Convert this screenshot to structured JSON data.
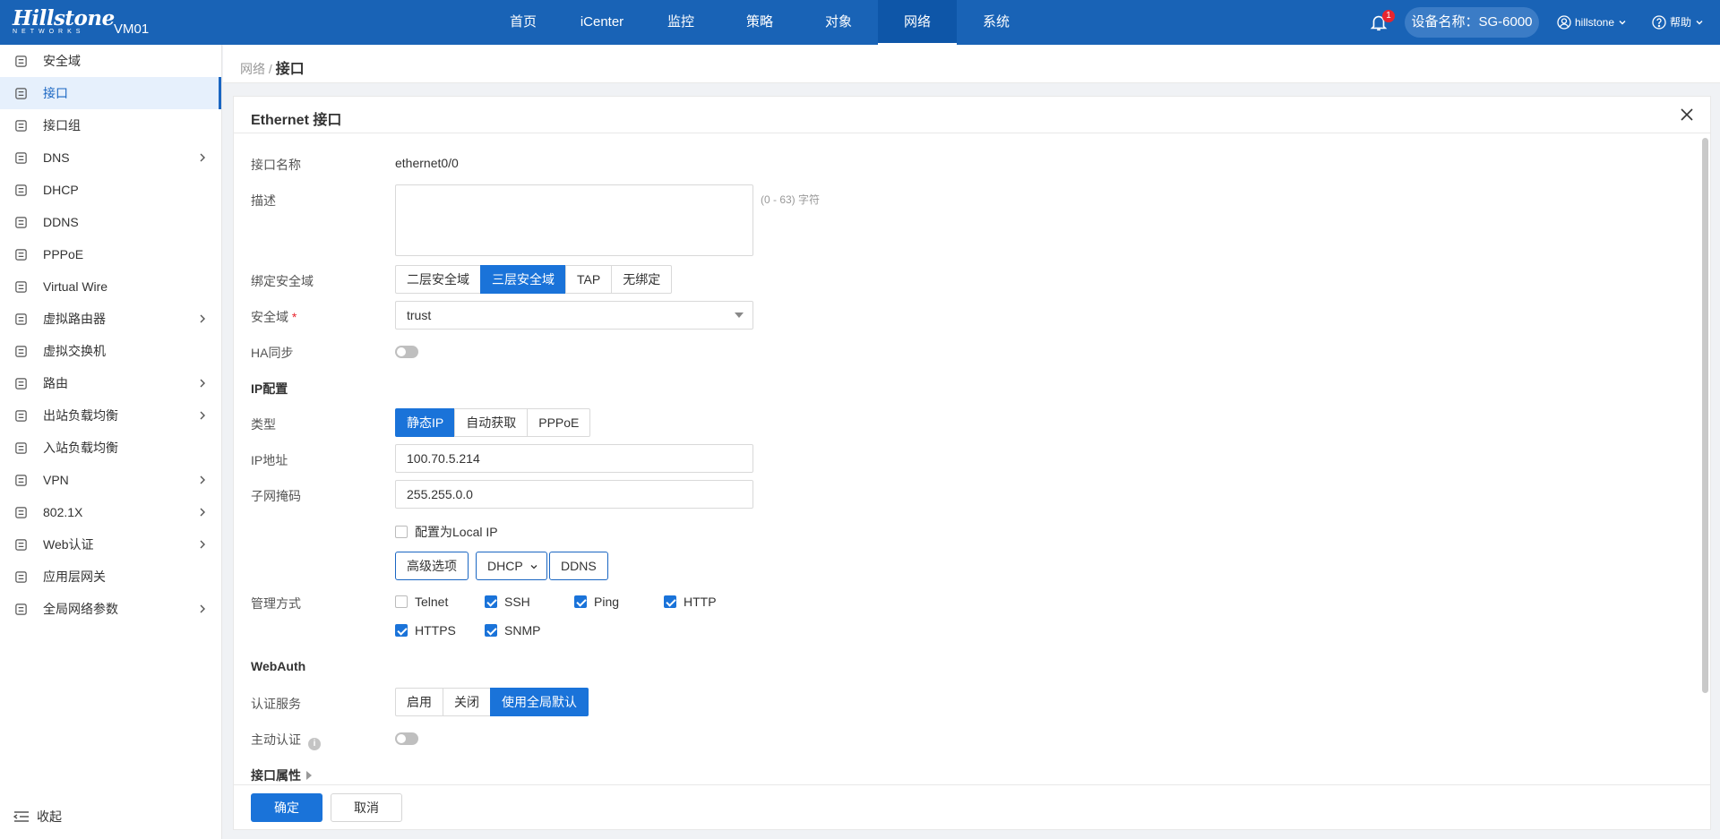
{
  "topbar": {
    "brand": "Hillstone",
    "brand_sub": "NETWORKS",
    "vm": "VM01",
    "nav": [
      "首页",
      "iCenter",
      "监控",
      "策略",
      "对象",
      "网络",
      "系统"
    ],
    "active_nav": "网络",
    "notification_count": "1",
    "device": "设备名称：SG-6000",
    "user": "hillstone",
    "help": "帮助"
  },
  "sidebar": {
    "items": [
      {
        "label": "安全域",
        "icon": "security-zone-icon"
      },
      {
        "label": "接口",
        "icon": "interface-icon"
      },
      {
        "label": "接口组",
        "icon": "interface-group-icon"
      },
      {
        "label": "DNS",
        "icon": "dns-icon"
      },
      {
        "label": "DHCP",
        "icon": "dhcp-icon"
      },
      {
        "label": "DDNS",
        "icon": "ddns-icon"
      },
      {
        "label": "PPPoE",
        "icon": "pppoe-icon"
      },
      {
        "label": "Virtual Wire",
        "icon": "virtual-wire-icon"
      },
      {
        "label": "虚拟路由器",
        "icon": "virtual-router-icon"
      },
      {
        "label": "虚拟交换机",
        "icon": "virtual-switch-icon"
      },
      {
        "label": "路由",
        "icon": "routing-icon"
      },
      {
        "label": "出站负载均衡",
        "icon": "outbound-lb-icon"
      },
      {
        "label": "入站负载均衡",
        "icon": "inbound-lb-icon"
      },
      {
        "label": "VPN",
        "icon": "vpn-icon"
      },
      {
        "label": "802.1X",
        "icon": "8021x-icon"
      },
      {
        "label": "Web认证",
        "icon": "web-auth-icon"
      },
      {
        "label": "应用层网关",
        "icon": "alg-icon"
      },
      {
        "label": "全局网络参数",
        "icon": "global-params-icon"
      }
    ],
    "active": "接口",
    "collapse": "收起"
  },
  "breadcrumb": {
    "parent": "网络",
    "sep": "/",
    "current": "接口"
  },
  "panel": {
    "title": "Ethernet 接口",
    "labels": {
      "name": "接口名称",
      "desc": "描述",
      "bind": "绑定安全域",
      "zone": "安全域",
      "ha": "HA同步",
      "ipconf": "IP配置",
      "type": "类型",
      "ip": "IP地址",
      "mask": "子网掩码",
      "mgmt": "管理方式",
      "webauth": "WebAuth",
      "auth_service": "认证服务",
      "active_auth": "主动认证",
      "props": "接口属性"
    },
    "name_value": "ethernet0/0",
    "desc_hint": "(0 - 63) 字符",
    "required_mark": "*",
    "bind_options": [
      "二层安全域",
      "三层安全域",
      "TAP",
      "无绑定"
    ],
    "bind_selected": "三层安全域",
    "zone_value": "trust",
    "type_options": [
      "静态IP",
      "自动获取",
      "PPPoE"
    ],
    "type_selected": "静态IP",
    "ip_value": "100.70.5.214",
    "mask_value": "255.255.0.0",
    "local_ip": "配置为Local IP",
    "btn_advanced": "高级选项",
    "btn_dhcp": "DHCP",
    "btn_ddns": "DDNS",
    "mgmt_options": [
      {
        "label": "Telnet",
        "checked": false
      },
      {
        "label": "SSH",
        "checked": true
      },
      {
        "label": "Ping",
        "checked": true
      },
      {
        "label": "HTTP",
        "checked": true
      },
      {
        "label": "HTTPS",
        "checked": true
      },
      {
        "label": "SNMP",
        "checked": true
      }
    ],
    "auth_options": [
      "启用",
      "关闭",
      "使用全局默认"
    ],
    "auth_selected": "使用全局默认",
    "info_glyph": "i",
    "ok": "确定",
    "cancel": "取消"
  }
}
